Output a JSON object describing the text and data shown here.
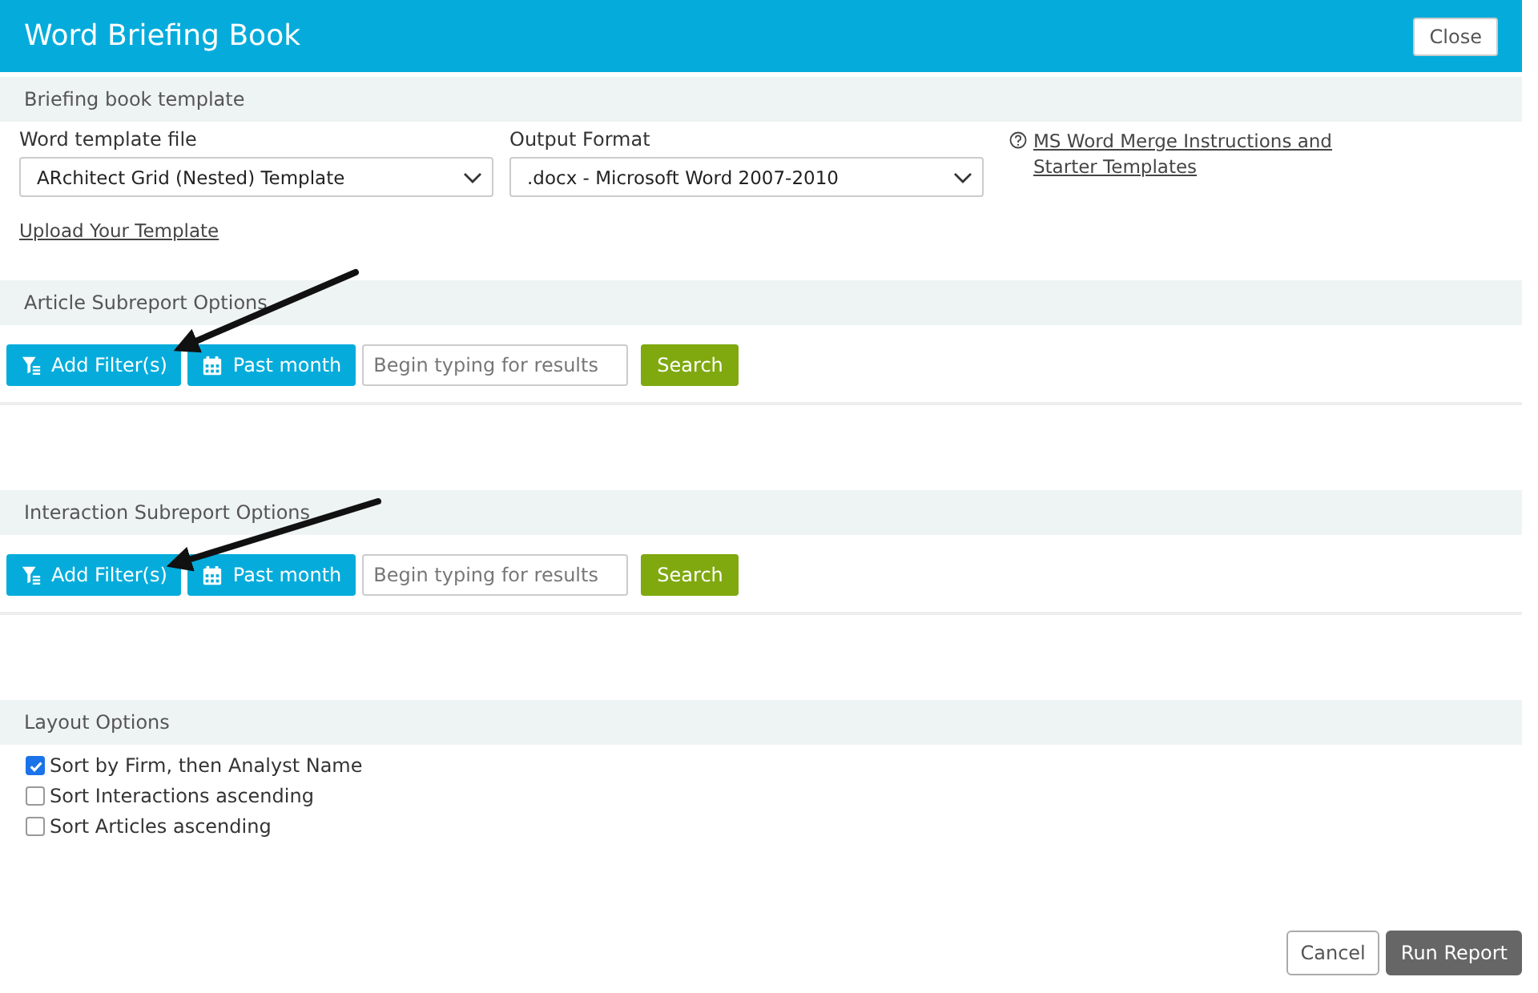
{
  "window": {
    "title": "Word Briefing Book",
    "close_button": "Close"
  },
  "template_section": {
    "heading": "Briefing book template",
    "fields": [
      {
        "label": "Word template file",
        "value": "ARchitect Grid (Nested) Template"
      },
      {
        "label": "Output Format",
        "value": ".docx - Microsoft Word 2007-2010"
      }
    ],
    "help_link": "MS Word Merge Instructions and Starter Templates",
    "upload_link": "Upload Your Template"
  },
  "subreports": [
    {
      "heading": "Article Subreport Options",
      "filter_button": "Add Filter(s)",
      "date_button": "Past month",
      "search": {
        "placeholder": "Begin typing for results"
      },
      "search_button": "Search"
    },
    {
      "heading": "Interaction Subreport Options",
      "filter_button": "Add Filter(s)",
      "date_button": "Past month",
      "search": {
        "placeholder": "Begin typing for results"
      },
      "search_button": "Search"
    }
  ],
  "layout_options": {
    "heading": "Layout Options",
    "options": [
      {
        "label": "Sort by Firm, then Analyst Name",
        "checked": true
      },
      {
        "label": "Sort Interactions ascending",
        "checked": false
      },
      {
        "label": "Sort Articles ascending",
        "checked": false
      }
    ]
  },
  "footer_buttons": [
    {
      "label": "Cancel",
      "kind": "secondary"
    },
    {
      "label": "Run Report",
      "kind": "primary"
    }
  ]
}
